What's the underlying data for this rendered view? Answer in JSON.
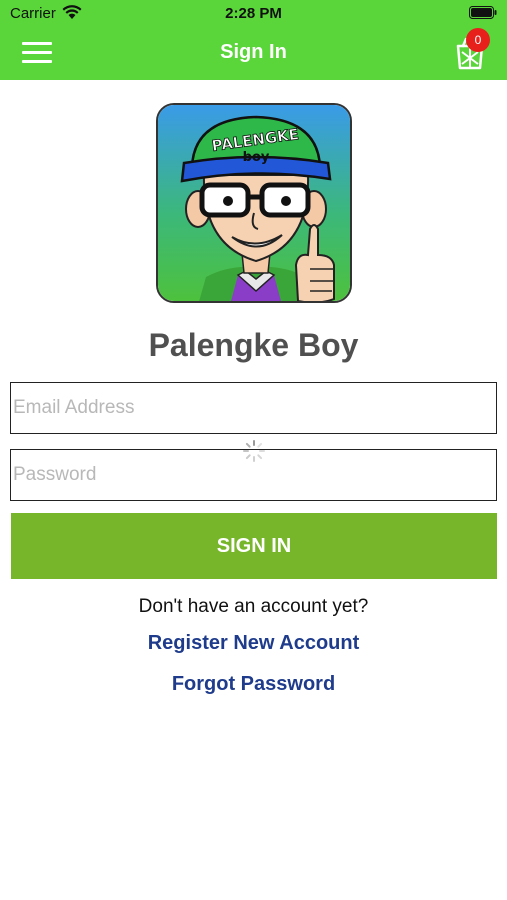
{
  "status_bar": {
    "carrier": "Carrier",
    "time": "2:28 PM"
  },
  "nav": {
    "title": "Sign In",
    "cart_count": "0"
  },
  "app": {
    "name": "Palengke Boy",
    "logo_text_line1": "PALENGKE",
    "logo_text_line2": "boy"
  },
  "form": {
    "email_placeholder": "Email Address",
    "password_placeholder": "Password",
    "sign_in_label": "SIGN IN"
  },
  "footer": {
    "no_account_text": "Don't have an account yet?",
    "register_label": "Register New Account",
    "forgot_label": "Forgot Password"
  },
  "colors": {
    "nav_green": "#5ad63a",
    "button_green": "#77b62a",
    "link_blue": "#1f3c8c",
    "badge_red": "#e8201c"
  }
}
